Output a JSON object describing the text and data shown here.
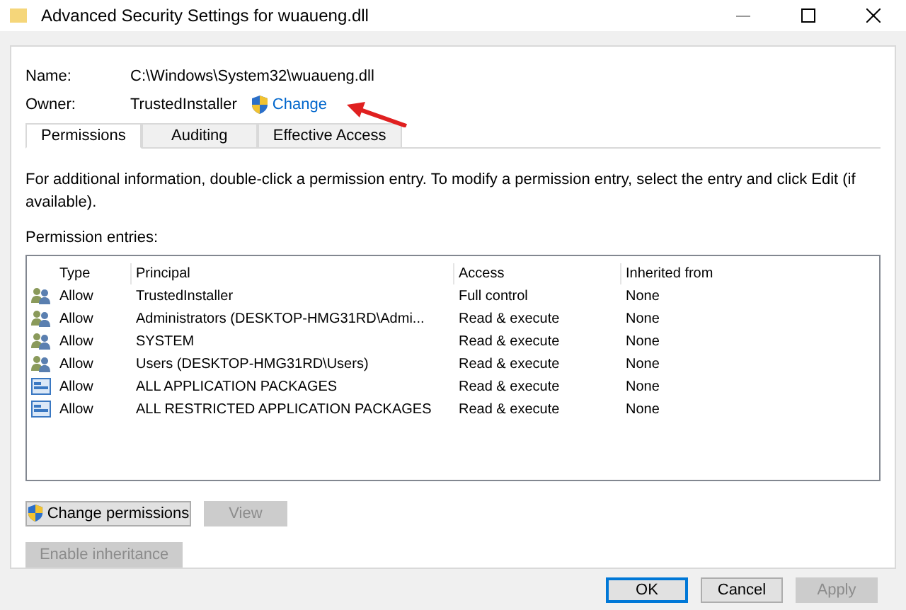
{
  "window": {
    "title": "Advanced Security Settings for wuaueng.dll"
  },
  "name": {
    "label": "Name:",
    "value": "C:\\Windows\\System32\\wuaueng.dll"
  },
  "owner": {
    "label": "Owner:",
    "value": "TrustedInstaller",
    "link": "Change"
  },
  "tabs": [
    {
      "label": "Permissions",
      "selected": true
    },
    {
      "label": "Auditing",
      "selected": false
    },
    {
      "label": "Effective Access",
      "selected": false
    }
  ],
  "info": "For additional information, double-click a permission entry. To modify a permission entry, select the entry and click Edit (if available).",
  "entries_label": "Permission entries:",
  "table": {
    "columns": [
      "Type",
      "Principal",
      "Access",
      "Inherited from"
    ],
    "rows": [
      {
        "kind": "group",
        "type": "Allow",
        "principal": "TrustedInstaller",
        "access": "Full control",
        "inherited": "None"
      },
      {
        "kind": "group",
        "type": "Allow",
        "principal": "Administrators (DESKTOP-HMG31RD\\Admi...",
        "access": "Read & execute",
        "inherited": "None"
      },
      {
        "kind": "group",
        "type": "Allow",
        "principal": "SYSTEM",
        "access": "Read & execute",
        "inherited": "None"
      },
      {
        "kind": "group",
        "type": "Allow",
        "principal": "Users (DESKTOP-HMG31RD\\Users)",
        "access": "Read & execute",
        "inherited": "None"
      },
      {
        "kind": "package",
        "type": "Allow",
        "principal": "ALL APPLICATION PACKAGES",
        "access": "Read & execute",
        "inherited": "None"
      },
      {
        "kind": "package",
        "type": "Allow",
        "principal": "ALL RESTRICTED APPLICATION PACKAGES",
        "access": "Read & execute",
        "inherited": "None"
      }
    ]
  },
  "actions": [
    {
      "label": "Change permissions",
      "shield": true,
      "disabled": false
    },
    {
      "label": "View",
      "shield": false,
      "disabled": true
    }
  ],
  "inheritance_button": {
    "label": "Enable inheritance",
    "disabled": true
  },
  "footer_buttons": [
    {
      "label": "OK",
      "disabled": false,
      "default": true
    },
    {
      "label": "Cancel",
      "disabled": false,
      "default": false
    },
    {
      "label": "Apply",
      "disabled": true,
      "default": false
    }
  ]
}
